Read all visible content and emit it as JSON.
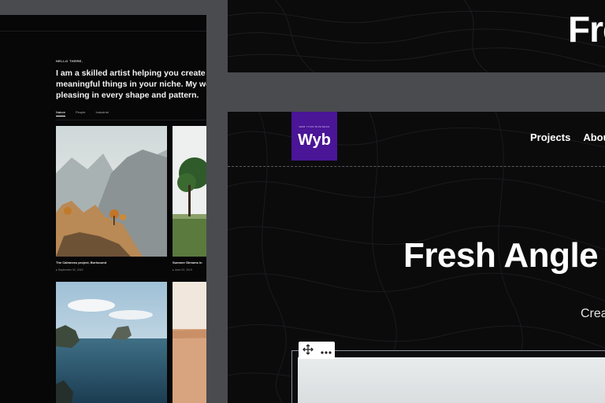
{
  "left_panel": {
    "eyebrow": "HELLO THERE,",
    "headline": "I am a skilled artist helping you create really meaningful things in your niche. My work is pleasing in every shape and pattern.",
    "tabs": [
      {
        "label": "Nature",
        "active": true
      },
      {
        "label": "People",
        "active": false
      },
      {
        "label": "Industrial",
        "active": false
      }
    ],
    "cards": [
      {
        "title": "The Calmness project, Bortsound",
        "date": "September 02, 2019"
      },
      {
        "title": "Summer Streams in",
        "date": "June 02, 2019"
      }
    ]
  },
  "top_right": {
    "big_text": "Fre"
  },
  "main": {
    "logo_tagline": "WEB YOUR BUSINESS",
    "logo_word": "Wyb",
    "nav": [
      {
        "label": "Projects"
      },
      {
        "label": "About"
      }
    ],
    "hero": "Fresh Angle",
    "subtitle": "Crea",
    "block_toolbar": {
      "move_icon": "move-icon",
      "more_icon": "more-options-icon"
    }
  },
  "colors": {
    "background": "#4a4b4f",
    "panel": "#0b0b0c",
    "logo": "#4a1596"
  }
}
